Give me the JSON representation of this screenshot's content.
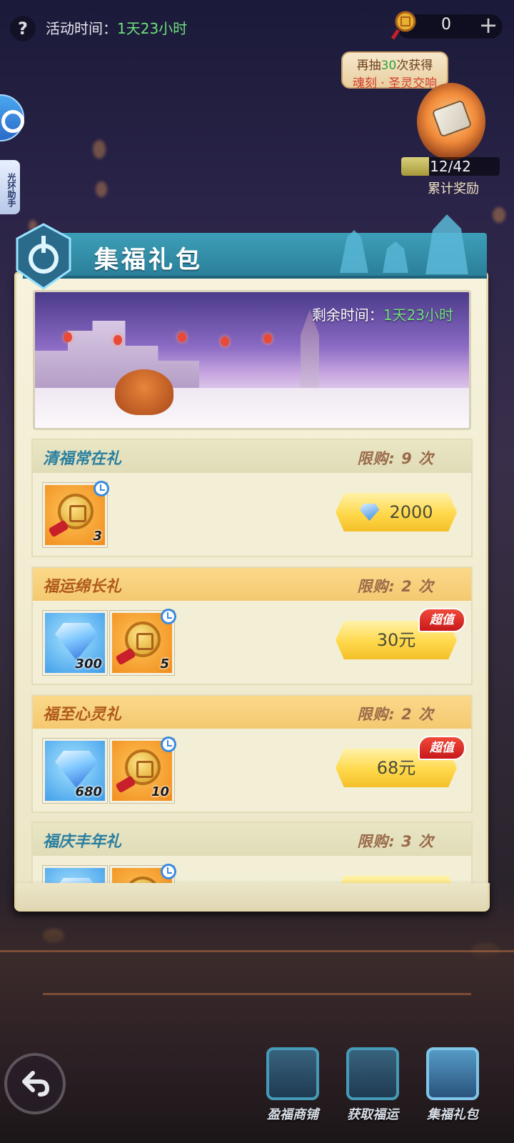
{
  "top_bar": {
    "help_label": "?",
    "activity_time_label": "活动时间：",
    "activity_time_value": "1天23小时",
    "currency_amount": "0",
    "add_label": "+"
  },
  "draw_reward": {
    "line1_prefix": "再抽",
    "line1_count": "30",
    "line1_suffix": "次获得",
    "line2": "魂刻 · 圣灵交响",
    "progress_text": "12/42",
    "progress_value": 0.2857,
    "label": "累计奖励"
  },
  "side": {
    "assistant_label": "光环助手"
  },
  "panel": {
    "title": "集福礼包"
  },
  "banner": {
    "time_label": "剩余时间：",
    "time_value": "1天23小时"
  },
  "gifts": [
    {
      "name": "清福常在礼",
      "limit": "限购: 9 次",
      "items": [
        {
          "type": "coin",
          "qty": "3"
        }
      ],
      "price": "2000",
      "price_currency_icon": "diamond-icon",
      "hot": ""
    },
    {
      "name": "福运绵长礼",
      "limit": "限购: 2 次",
      "items": [
        {
          "type": "gem",
          "qty": "300"
        },
        {
          "type": "coin",
          "qty": "5"
        }
      ],
      "price": "30元",
      "hot": "超值"
    },
    {
      "name": "福至心灵礼",
      "limit": "限购: 2 次",
      "items": [
        {
          "type": "gem",
          "qty": "680"
        },
        {
          "type": "coin",
          "qty": "10"
        }
      ],
      "price": "68元",
      "hot": "超值"
    },
    {
      "name": "福庆丰年礼",
      "limit": "限购: 3 次",
      "items": [
        {
          "type": "gem",
          "qty": ""
        },
        {
          "type": "coin",
          "qty": ""
        }
      ],
      "price": "",
      "hot": ""
    }
  ],
  "bottom_nav": [
    {
      "label": "盈福商铺",
      "icon": "treasure-chest-icon"
    },
    {
      "label": "获取福运",
      "icon": "scroll-icon"
    },
    {
      "label": "集福礼包",
      "icon": "gift-box-icon"
    }
  ],
  "colors": {
    "title_bar": "#2b7f99",
    "highlight_green": "#6fe07a",
    "price_button": "#ffd84a",
    "hot_badge": "#c8181a"
  }
}
